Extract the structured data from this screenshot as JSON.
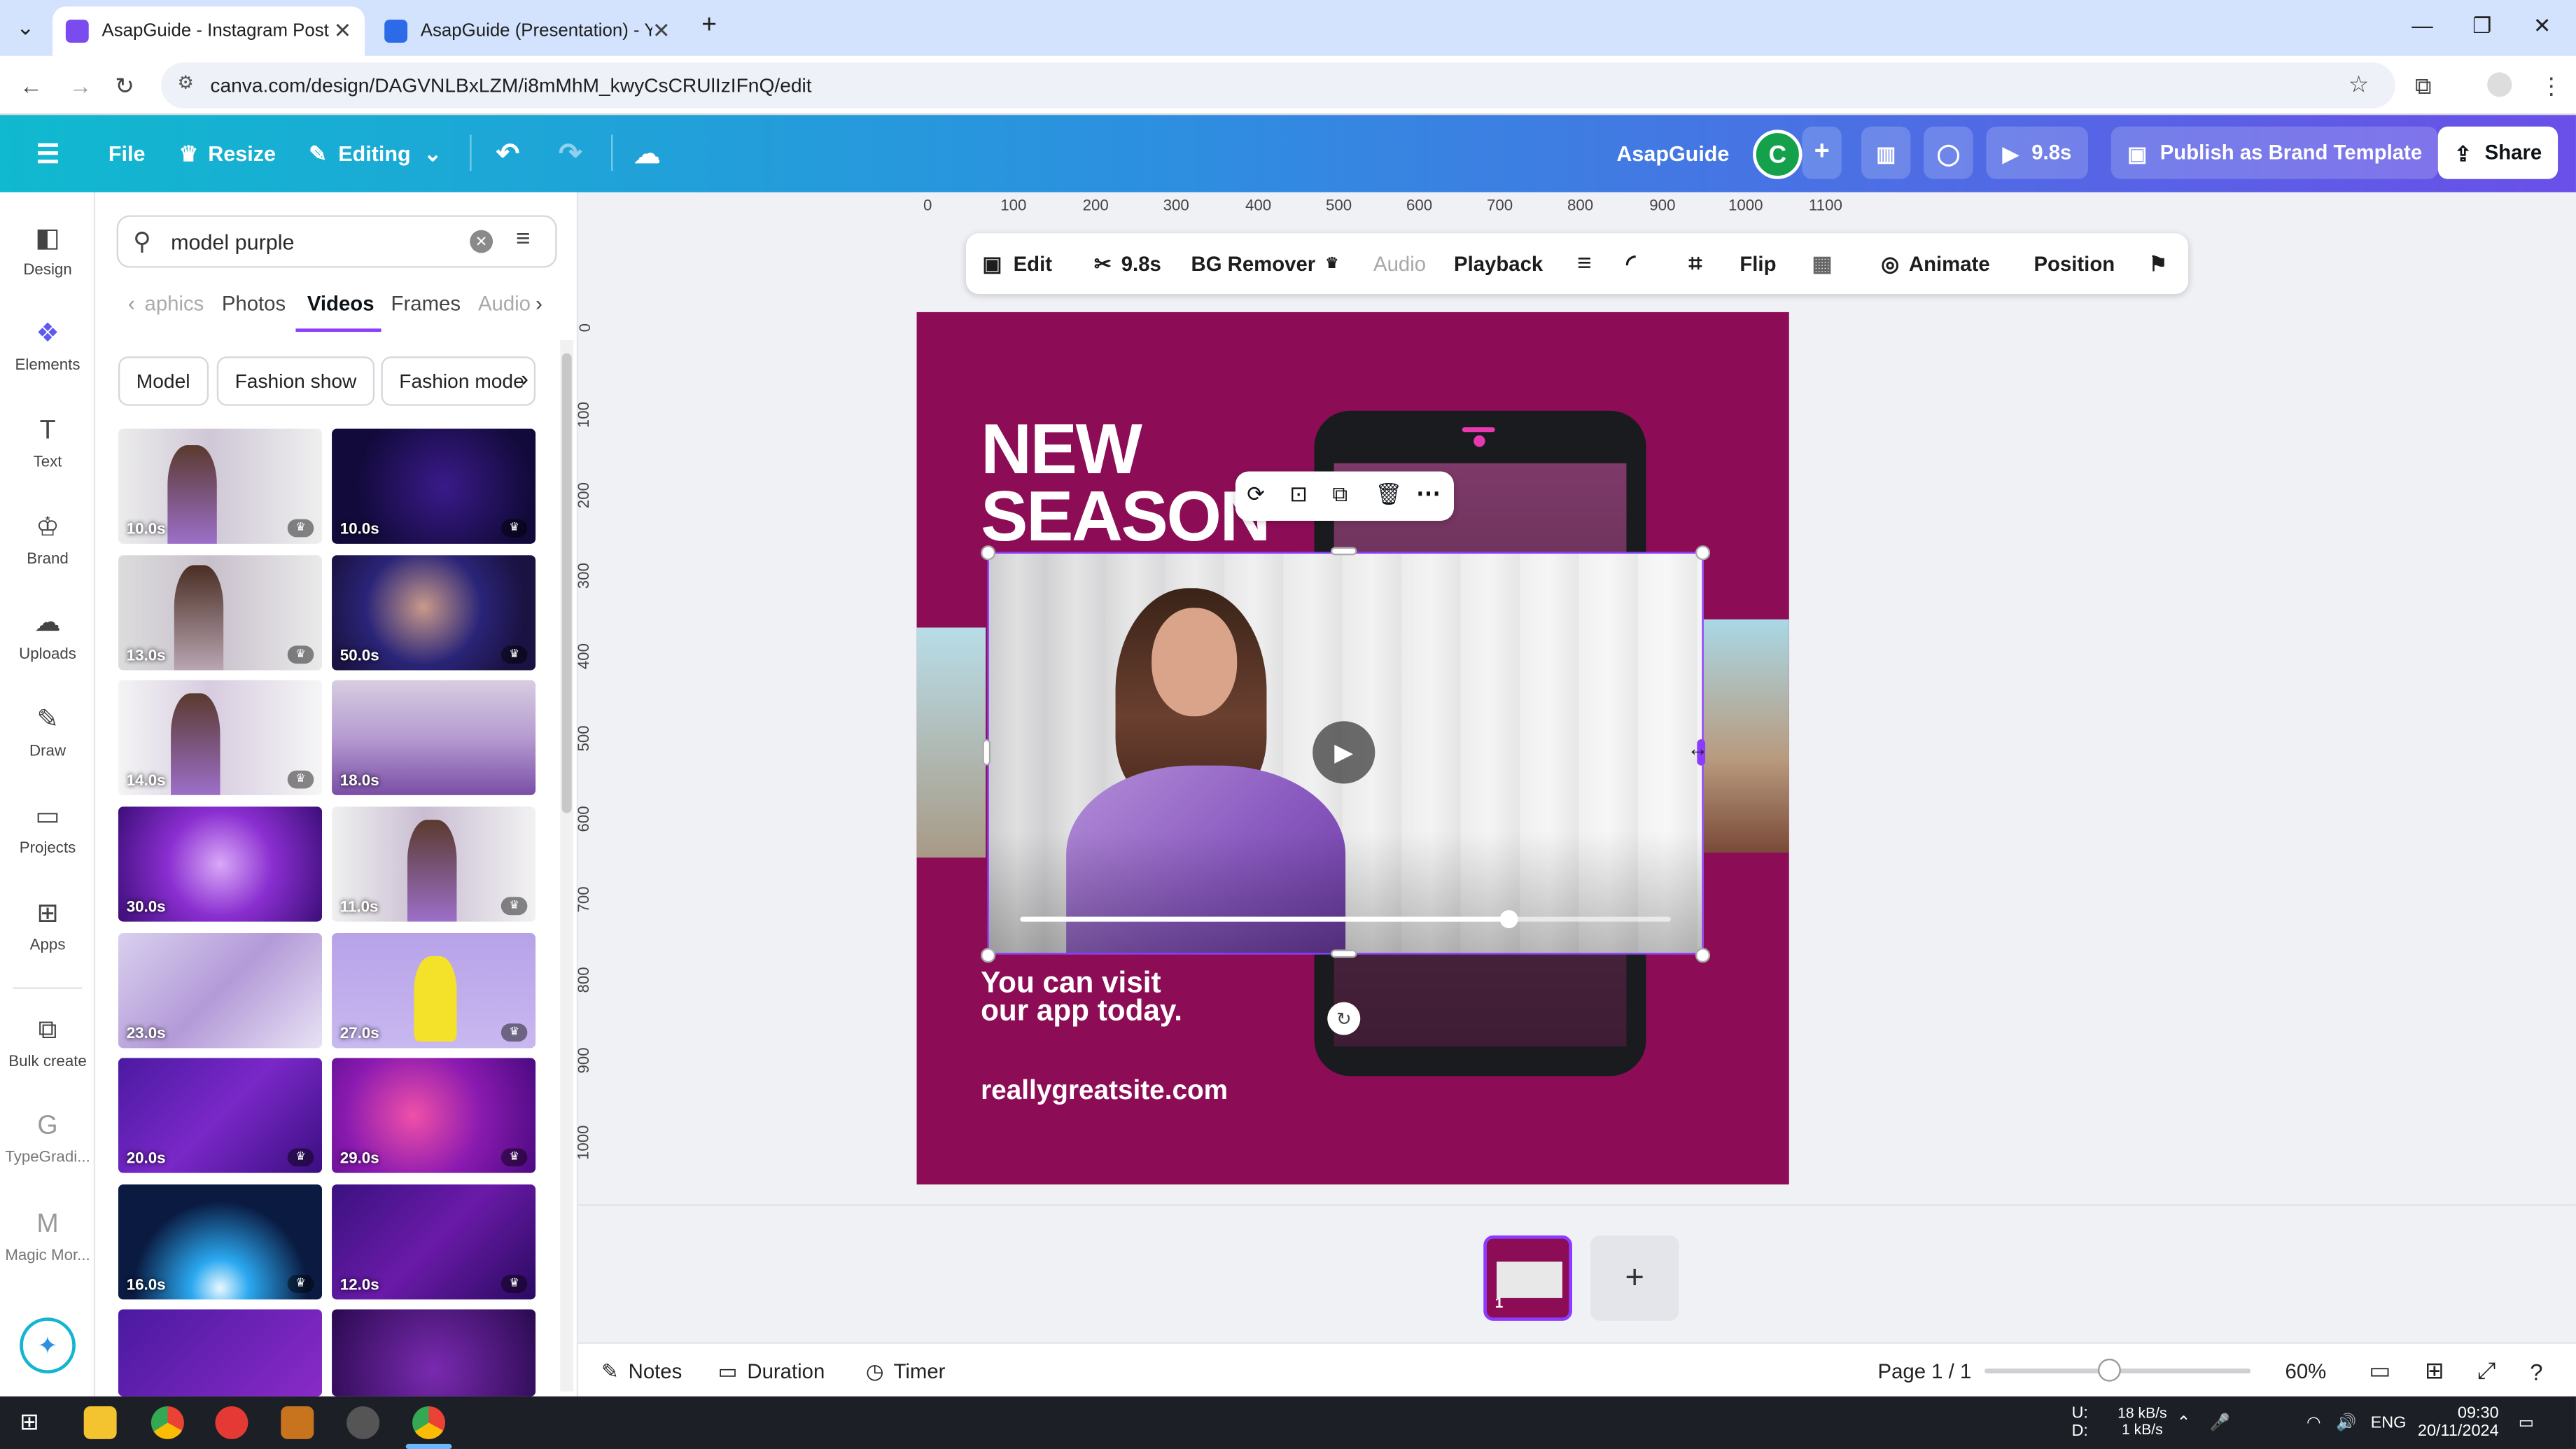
{
  "browser": {
    "tabs": [
      {
        "label": "AsapGuide - Instagram Post",
        "active": true
      },
      {
        "label": "AsapGuide (Presentation) - You",
        "active": false
      }
    ],
    "url": "canva.com/design/DAGVNLBxLZM/i8mMhM_kwyCsCRUlIzIFnQ/edit"
  },
  "header": {
    "file": "File",
    "resize": "Resize",
    "editing": "Editing",
    "project_name": "AsapGuide",
    "avatar_initial": "C",
    "play_duration": "9.8s",
    "publish": "Publish as Brand Template",
    "share": "Share"
  },
  "rail": [
    {
      "label": "Design",
      "icon": "design-icon"
    },
    {
      "label": "Elements",
      "icon": "elements-icon"
    },
    {
      "label": "Text",
      "icon": "text-icon"
    },
    {
      "label": "Brand",
      "icon": "brand-icon"
    },
    {
      "label": "Uploads",
      "icon": "uploads-icon"
    },
    {
      "label": "Draw",
      "icon": "draw-icon"
    },
    {
      "label": "Projects",
      "icon": "projects-icon"
    },
    {
      "label": "Apps",
      "icon": "apps-icon"
    },
    {
      "label": "Bulk create",
      "icon": "bulk-create-icon"
    },
    {
      "label": "TypeGradi...",
      "icon": "typegradient-icon"
    },
    {
      "label": "Magic Mor...",
      "icon": "magic-morph-icon"
    }
  ],
  "panel": {
    "search_value": "model purple",
    "tabs": [
      "aphics",
      "Photos",
      "Videos",
      "Frames",
      "Audio"
    ],
    "active_tab": "Videos",
    "chips": [
      "Model",
      "Fashion show",
      "Fashion mode"
    ],
    "videos": [
      {
        "duration": "10.0s"
      },
      {
        "duration": "10.0s"
      },
      {
        "duration": "13.0s"
      },
      {
        "duration": "50.0s"
      },
      {
        "duration": "14.0s"
      },
      {
        "duration": "18.0s"
      },
      {
        "duration": "30.0s"
      },
      {
        "duration": "11.0s"
      },
      {
        "duration": "23.0s"
      },
      {
        "duration": "27.0s"
      },
      {
        "duration": "20.0s"
      },
      {
        "duration": "29.0s"
      },
      {
        "duration": "16.0s"
      },
      {
        "duration": "12.0s"
      },
      {
        "duration": ""
      },
      {
        "duration": ""
      }
    ]
  },
  "ruler": {
    "x": [
      "0",
      "100",
      "200",
      "300",
      "400",
      "500",
      "600",
      "700",
      "800",
      "900",
      "1000",
      "1100"
    ],
    "y": [
      "0",
      "100",
      "200",
      "300",
      "400",
      "500",
      "600",
      "700",
      "800",
      "900",
      "1000"
    ]
  },
  "toolbar": {
    "edit": "Edit",
    "trim": "9.8s",
    "bg_remover": "BG Remover",
    "audio": "Audio",
    "playback": "Playback",
    "flip": "Flip",
    "animate": "Animate",
    "position": "Position"
  },
  "design": {
    "headline_1": "NEW",
    "headline_2": "SEASON",
    "sub_1": "You can visit",
    "sub_2": "our app today.",
    "url": "reallygreatsite.com",
    "bg_color": "#8c0d56",
    "video_progress": 0.75
  },
  "pages": {
    "thumb_number": "1"
  },
  "footer": {
    "notes": "Notes",
    "duration": "Duration",
    "timer": "Timer",
    "page": "Page 1 / 1",
    "zoom": "60%"
  },
  "taskbar": {
    "net_up": "18 kB/s",
    "net_down": "1 kB/s",
    "u": "U:",
    "d": "D:",
    "lang": "ENG",
    "time": "09:30",
    "date": "20/11/2024"
  }
}
